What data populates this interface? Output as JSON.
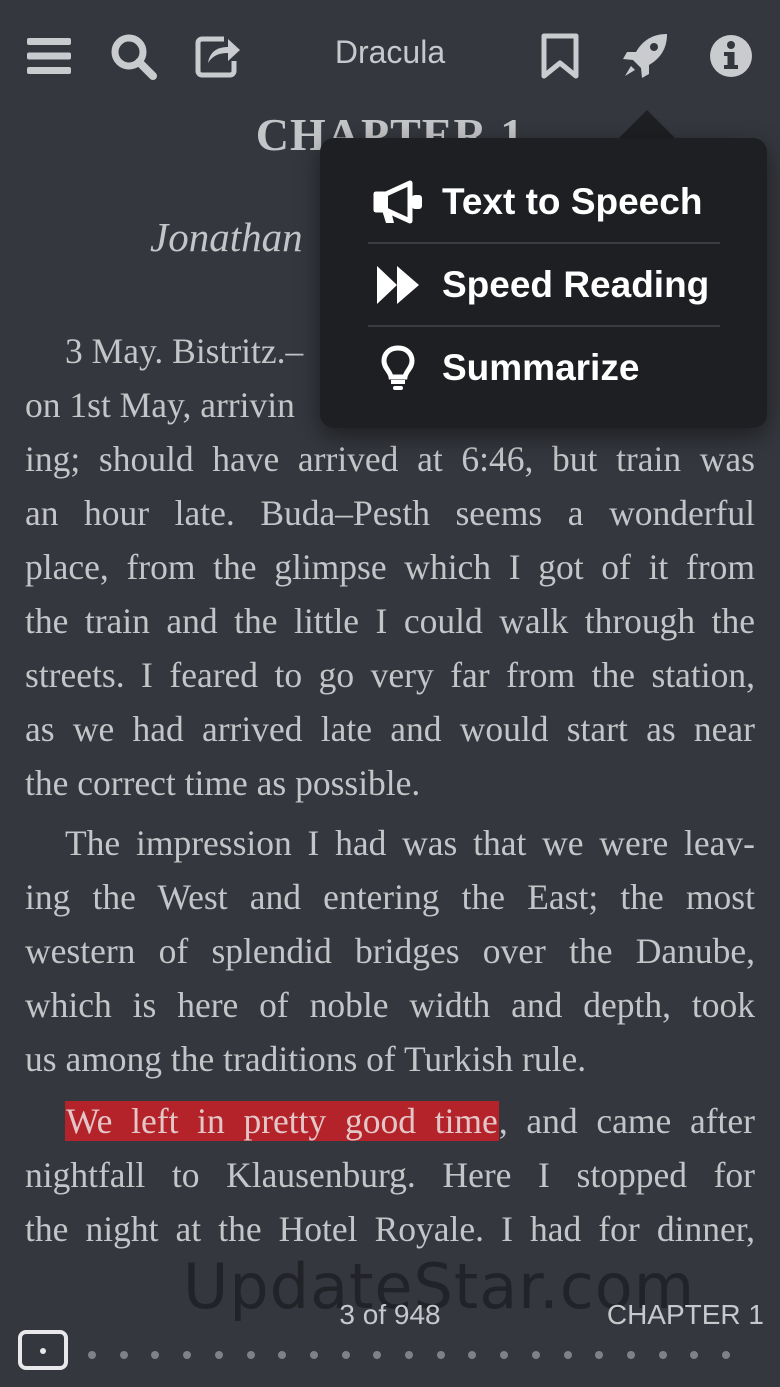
{
  "toolbar": {
    "title": "Dracula",
    "icons": [
      "menu-icon",
      "search-icon",
      "share-icon",
      "bookmark-icon",
      "rocket-icon",
      "info-icon"
    ]
  },
  "page": {
    "chapter_heading": "CHAPTER 1",
    "author_line": "Jonathan",
    "lines": [
      "3 May. Bistritz.–",
      "on 1st May, arrivin",
      "ing; should have arrived at 6:46, but train was",
      "an hour late. Buda–Pesth seems a wonderful",
      "place, from the glimpse which I got of it from",
      "the train and the little I could walk through the",
      "streets. I feared to go very far from the station,",
      "as we had arrived late and would start as near",
      "the correct time as possible.",
      "The impression I had was that we were leav-",
      "ing the West and entering the East; the most",
      "western of splendid bridges over the Danube,",
      "which is here of noble width and depth, took",
      "us among the traditions of Turkish rule.",
      "We left in pretty good time",
      ", and came after",
      "nightfall to Klausenburg. Here I stopped for",
      "the night at the Hotel Royale. I had for dinner,"
    ]
  },
  "popover": {
    "items": [
      {
        "label": "Text to Speech",
        "icon": "megaphone-icon"
      },
      {
        "label": "Speed Reading",
        "icon": "fast-forward-icon"
      },
      {
        "label": "Summarize",
        "icon": "lightbulb-icon"
      }
    ]
  },
  "watermark": "UpdateStar.com",
  "footer": {
    "page_count": "3 of 948",
    "chapter_label": "CHAPTER 1",
    "progress_fraction": 0.002
  },
  "colors": {
    "background": "#34373d",
    "text": "#c4c5c8",
    "highlight": "#b5232a",
    "popover": "#1e1f22"
  }
}
